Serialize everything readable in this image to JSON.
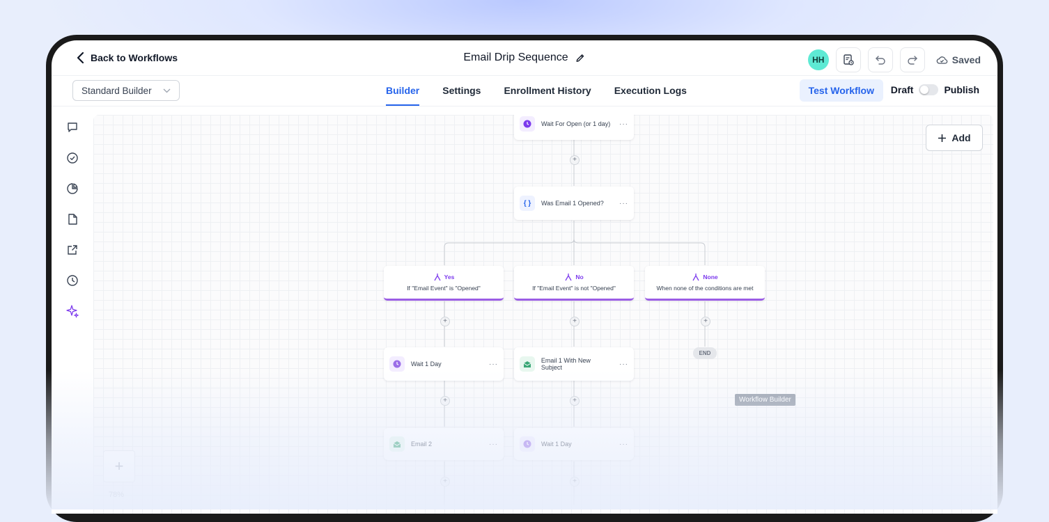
{
  "header": {
    "back_label": "Back to Workflows",
    "title": "Email Drip Sequence",
    "avatar_initials": "HH",
    "saved_label": "Saved"
  },
  "subbar": {
    "builder_select": "Standard Builder",
    "tabs": [
      {
        "label": "Builder",
        "active": true
      },
      {
        "label": "Settings",
        "active": false
      },
      {
        "label": "Enrollment History",
        "active": false
      },
      {
        "label": "Execution Logs",
        "active": false
      }
    ],
    "test_button": "Test Workflow",
    "draft_label": "Draft",
    "publish_label": "Publish"
  },
  "canvas": {
    "add_button": "Add",
    "nodes": {
      "wait_for_open": "Wait For Open (or 1 day)",
      "condition": "Was Email 1 Opened?",
      "wait_1_day": "Wait 1 Day",
      "email_new_subject": "Email 1 With New Subject",
      "email_2": "Email 2",
      "wait_1_day_b": "Wait 1 Day"
    },
    "branches": {
      "yes_label": "Yes",
      "yes_desc": "If \"Email Event\" is \"Opened\"",
      "no_label": "No",
      "no_desc": "If \"Email Event\" is not \"Opened\"",
      "none_label": "None",
      "none_desc": "When none of the conditions are met"
    },
    "end_label": "END",
    "tooltip": "Workflow Builder",
    "zoom_label": "78%",
    "condition_icon": "{ }",
    "more": "···"
  },
  "colors": {
    "accent": "#2563eb",
    "branch_purple": "#7c3aed",
    "avatar": "#5eead4"
  }
}
